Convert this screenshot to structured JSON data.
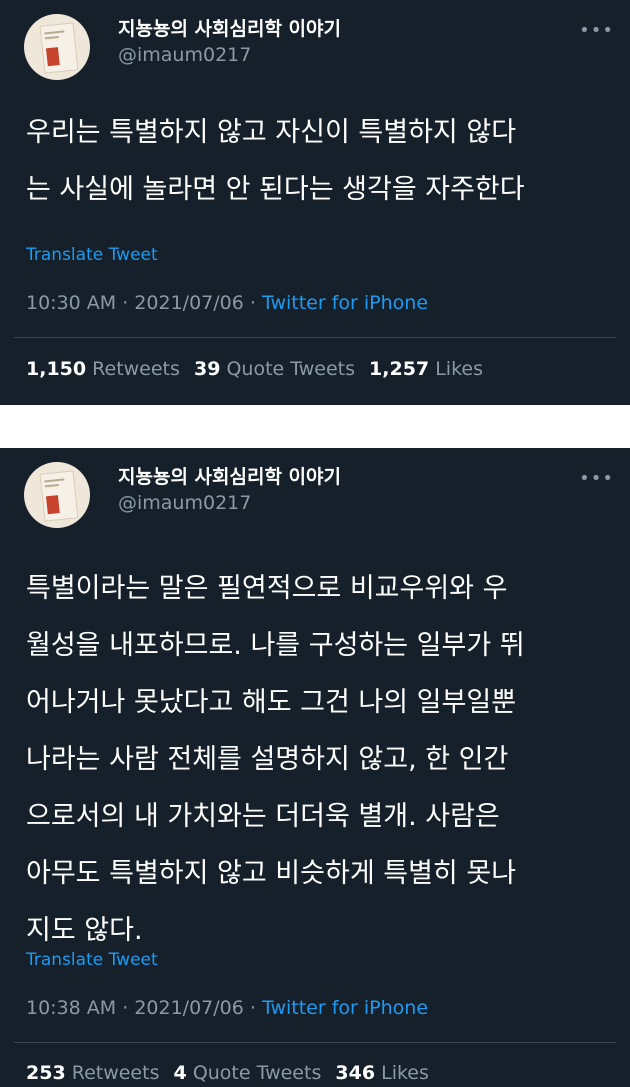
{
  "tweets": [
    {
      "author": {
        "display_name": "지뇽뇽의 사회심리학 이야기",
        "handle": "@imaum0217",
        "avatar_icon": "book-cover-avatar"
      },
      "more_icon": "•••",
      "text": "우리는 특별하지 않고 자신이 특별하지 않다\n는 사실에 놀라면 안 된다는 생각을 자주한다",
      "translate": "Translate Tweet",
      "time": "10:30 AM",
      "separator": "·",
      "date": "2021/07/06",
      "source": "Twitter for iPhone",
      "stats": {
        "retweets_count": "1,150",
        "retweets_label": "Retweets",
        "quotes_count": "39",
        "quotes_label": "Quote Tweets",
        "likes_count": "1,257",
        "likes_label": "Likes"
      }
    },
    {
      "author": {
        "display_name": "지뇽뇽의 사회심리학 이야기",
        "handle": "@imaum0217",
        "avatar_icon": "book-cover-avatar"
      },
      "more_icon": "•••",
      "text": "특별이라는 말은 필연적으로 비교우위와 우\n월성을 내포하므로. 나를 구성하는 일부가 뛰\n어나거나 못났다고 해도 그건 나의 일부일뿐\n나라는 사람 전체를 설명하지 않고, 한 인간\n으로서의 내 가치와는 더더욱 별개. 사람은\n아무도 특별하지 않고 비슷하게 특별히 못나\n지도 않다.",
      "translate": "Translate Tweet",
      "time": "10:38 AM",
      "separator": "·",
      "date": "2021/07/06",
      "source": "Twitter for iPhone",
      "stats": {
        "retweets_count": "253",
        "retweets_label": "Retweets",
        "quotes_count": "4",
        "quotes_label": "Quote Tweets",
        "likes_count": "346",
        "likes_label": "Likes"
      }
    }
  ],
  "colors": {
    "background": "#15202b",
    "text": "#ffffff",
    "secondary": "#8b98a5",
    "accent": "#1d9bf0",
    "divider": "#38444d"
  }
}
